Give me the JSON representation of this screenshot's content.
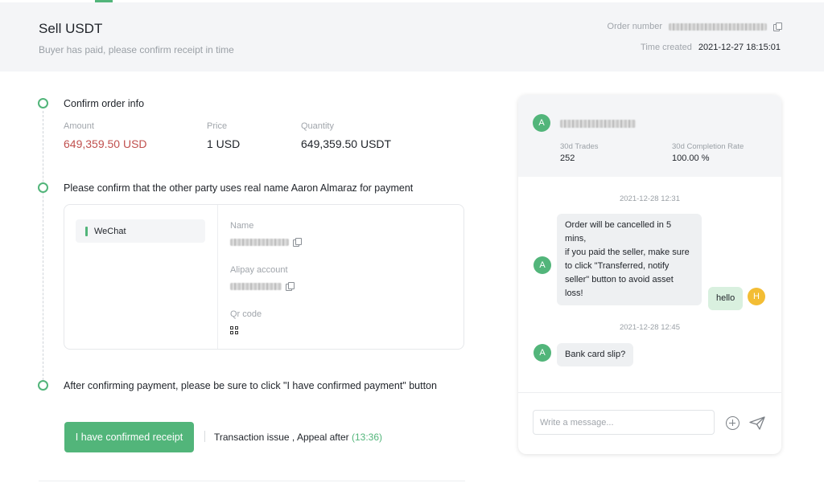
{
  "header": {
    "title": "Sell USDT",
    "subtitle": "Buyer has paid, please confirm receipt in time",
    "order_number_label": "Order number",
    "time_created_label": "Time created",
    "time_created_value": "2021-12-27 18:15:01"
  },
  "steps": {
    "step1_title": "Confirm order info",
    "step2_title": "Please confirm that the other party uses real name Aaron Almaraz for payment",
    "step3_title": "After confirming payment, please be sure to click \"I have confirmed payment\" button"
  },
  "order_info": {
    "amount_label": "Amount",
    "amount_value": "649,359.50 USD",
    "price_label": "Price",
    "price_value": "1 USD",
    "quantity_label": "Quantity",
    "quantity_value": "649,359.50 USDT"
  },
  "payment": {
    "method": "WeChat",
    "name_label": "Name",
    "account_label": "Alipay account",
    "qr_label": "Qr code"
  },
  "actions": {
    "confirm_button": "I have confirmed receipt",
    "appeal_prefix": "Transaction issue , Appeal after ",
    "appeal_time": "(13:36)"
  },
  "chat": {
    "counterparty_initial": "A",
    "trades_label": "30d Trades",
    "trades_value": "252",
    "completion_label": "30d Completion Rate",
    "completion_value": "100.00 %",
    "messages": [
      {
        "time": "2021-12-28 12:31"
      },
      {
        "from": "A",
        "line1": "Order will be cancelled in 5 mins,",
        "line2": "if you paid the seller, make sure",
        "line3": "to click \"Transferred, notify",
        "line4": "seller\" button to avoid asset loss!"
      },
      {
        "from": "H",
        "text": "hello"
      },
      {
        "time": "2021-12-28 12:45"
      },
      {
        "from": "A",
        "text": "Bank card slip?"
      }
    ],
    "input_placeholder": "Write a message...",
    "icons": {
      "attach": "plus-circle-icon",
      "send": "paper-plane-icon"
    }
  },
  "colors": {
    "accent": "#52b57a",
    "amount_red": "#c0504e",
    "avatar_user": "#f3bd34"
  }
}
